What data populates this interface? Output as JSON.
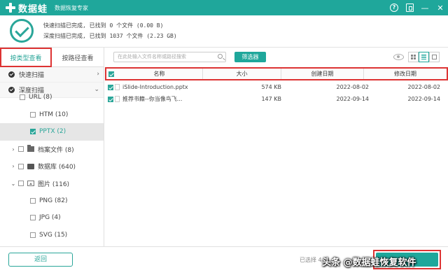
{
  "app": {
    "name": "数据蛙",
    "subtitle": "数据恢复专家"
  },
  "window_controls": [
    "help-icon",
    "pin-icon",
    "minimize-icon",
    "close-icon"
  ],
  "scan": {
    "quick": "快速扫描已完成, 已找到  0 个文件 (0.00  B)",
    "deep": "深度扫描已完成, 已找到 1037 个文件 (2.23 GB)"
  },
  "sidebar": {
    "tabs": [
      {
        "label": "按类型查看",
        "active": true
      },
      {
        "label": "按路径查看",
        "active": false
      }
    ],
    "modes": [
      {
        "label": "快速扫描",
        "arrow": "›"
      },
      {
        "label": "深度扫描",
        "arrow": "⌄"
      }
    ],
    "tree": [
      {
        "label": "URL (8)",
        "indent": 1,
        "checked": false
      },
      {
        "label": "HTM (10)",
        "indent": 1,
        "checked": false
      },
      {
        "label": "PPTX (2)",
        "indent": 1,
        "checked": true,
        "selected": true
      },
      {
        "label": "档案文件 (8)",
        "indent": 0,
        "caret": "›",
        "icon": "folder-icon"
      },
      {
        "label": "数据库 (640)",
        "indent": 0,
        "caret": "›",
        "icon": "db-icon"
      },
      {
        "label": "图片 (116)",
        "indent": 0,
        "caret": "⌄",
        "icon": "img-icon"
      },
      {
        "label": "PNG (82)",
        "indent": 1,
        "checked": false
      },
      {
        "label": "JPG (4)",
        "indent": 1,
        "checked": false
      },
      {
        "label": "SVG (15)",
        "indent": 1,
        "checked": false
      }
    ]
  },
  "toolbar": {
    "search_placeholder": "在此处输入文件名称或路径搜索",
    "filter_label": "筛选器"
  },
  "table": {
    "columns": [
      "名称",
      "大小",
      "创建日期",
      "修改日期"
    ],
    "rows": [
      {
        "name": "iSlide-Introduction.pptx",
        "size": "574 KB",
        "created": "2022-08-02",
        "modified": "2022-08-02"
      },
      {
        "name": "推荐书籍--你当像鸟飞...",
        "size": "147 KB",
        "created": "2022-09-14",
        "modified": "2022-09-14"
      }
    ]
  },
  "footer": {
    "back_label": "返回",
    "selected_text": "已选择 4",
    "watermark": "头条 @数据蛙恢复软件"
  },
  "colors": {
    "accent": "#1fa79b",
    "highlight": "#dd3333"
  }
}
